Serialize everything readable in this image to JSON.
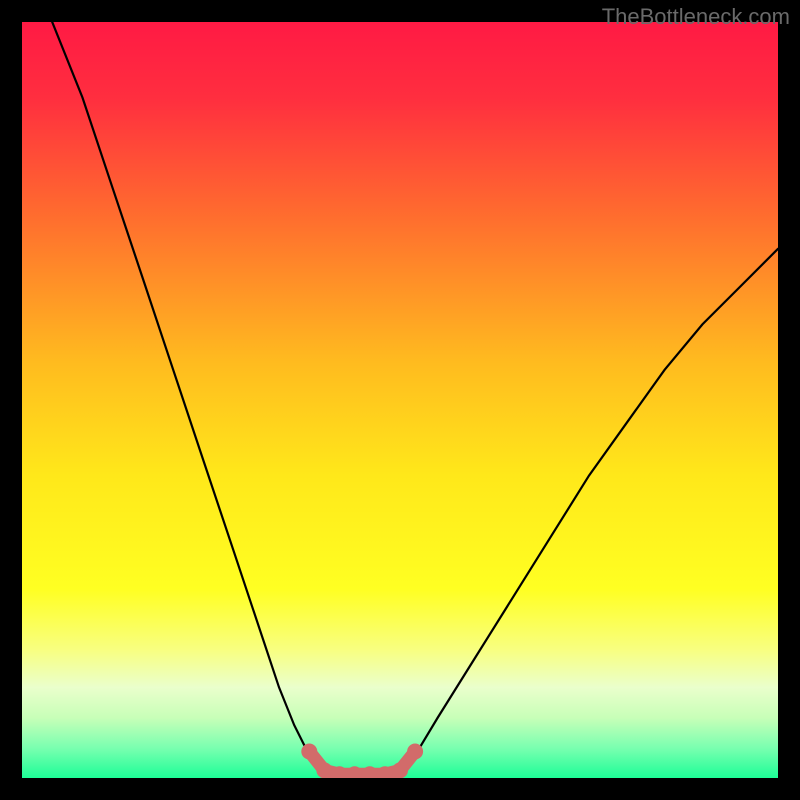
{
  "watermark": "TheBottleneck.com",
  "colors": {
    "background": "#000000",
    "gradient_stops": [
      {
        "offset": 0.0,
        "color": "#ff1a44"
      },
      {
        "offset": 0.1,
        "color": "#ff2e3f"
      },
      {
        "offset": 0.25,
        "color": "#ff6a2f"
      },
      {
        "offset": 0.45,
        "color": "#ffbb1f"
      },
      {
        "offset": 0.6,
        "color": "#ffe81a"
      },
      {
        "offset": 0.75,
        "color": "#ffff22"
      },
      {
        "offset": 0.83,
        "color": "#f8ff80"
      },
      {
        "offset": 0.88,
        "color": "#eaffcc"
      },
      {
        "offset": 0.92,
        "color": "#c8ffb8"
      },
      {
        "offset": 0.96,
        "color": "#7affb0"
      },
      {
        "offset": 1.0,
        "color": "#1dfe97"
      }
    ],
    "curve": "#000000",
    "bottom_mark": "#d26b6a"
  },
  "chart_data": {
    "type": "line",
    "title": "",
    "xlabel": "",
    "ylabel": "",
    "xlim": [
      0,
      100
    ],
    "ylim": [
      0,
      100
    ],
    "series": [
      {
        "name": "left_curve",
        "x": [
          4,
          8,
          12,
          16,
          20,
          24,
          28,
          32,
          34,
          36,
          38,
          40
        ],
        "y": [
          100,
          90,
          78,
          66,
          54,
          42,
          30,
          18,
          12,
          7,
          3,
          0.5
        ]
      },
      {
        "name": "right_curve",
        "x": [
          50,
          52,
          55,
          60,
          65,
          70,
          75,
          80,
          85,
          90,
          95,
          100
        ],
        "y": [
          0.5,
          3,
          8,
          16,
          24,
          32,
          40,
          47,
          54,
          60,
          65,
          70
        ]
      },
      {
        "name": "bottom_segment",
        "x": [
          38,
          40,
          42,
          44,
          46,
          48,
          50,
          52
        ],
        "y": [
          3.5,
          1.0,
          0.5,
          0.5,
          0.5,
          0.5,
          1.0,
          3.5
        ]
      }
    ],
    "annotations": []
  }
}
